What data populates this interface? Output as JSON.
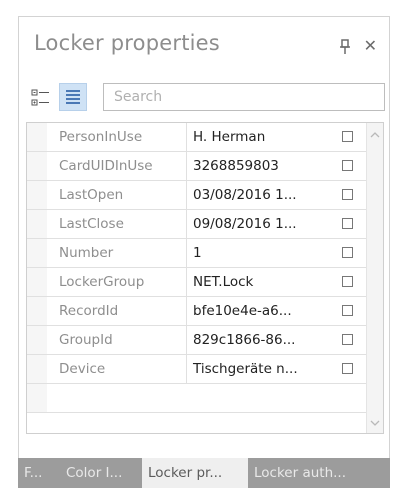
{
  "panel": {
    "title": "Locker properties",
    "pin_icon": "pin-icon",
    "close_glyph": "✕"
  },
  "toolbar": {
    "categorized_icon": "categorized-view-icon",
    "alphabetical_icon": "alphabetical-view-icon",
    "search_placeholder": "Search"
  },
  "properties": [
    {
      "name": "PersonInUse",
      "value": "H. Herman"
    },
    {
      "name": "CardUIDInUse",
      "value": "3268859803"
    },
    {
      "name": "LastOpen",
      "value": "03/08/2016 1..."
    },
    {
      "name": "LastClose",
      "value": "09/08/2016 1..."
    },
    {
      "name": "Number",
      "value": "1"
    },
    {
      "name": "LockerGroup",
      "value": "NET.Lock"
    },
    {
      "name": "RecordId",
      "value": "bfe10e4e-a6..."
    },
    {
      "name": "GroupId",
      "value": "829c1866-86..."
    },
    {
      "name": "Device",
      "value": "Tischgeräte n..."
    }
  ],
  "tabs": [
    {
      "label": "F...",
      "active": false
    },
    {
      "label": "Color I...",
      "active": false
    },
    {
      "label": "Locker pr...",
      "active": true
    },
    {
      "label": "Locker auth...",
      "active": false
    }
  ],
  "colors": {
    "tab_bar": "#9c9c9c",
    "active_tab": "#efefef",
    "alpha_highlight": "#cfe2f5"
  }
}
